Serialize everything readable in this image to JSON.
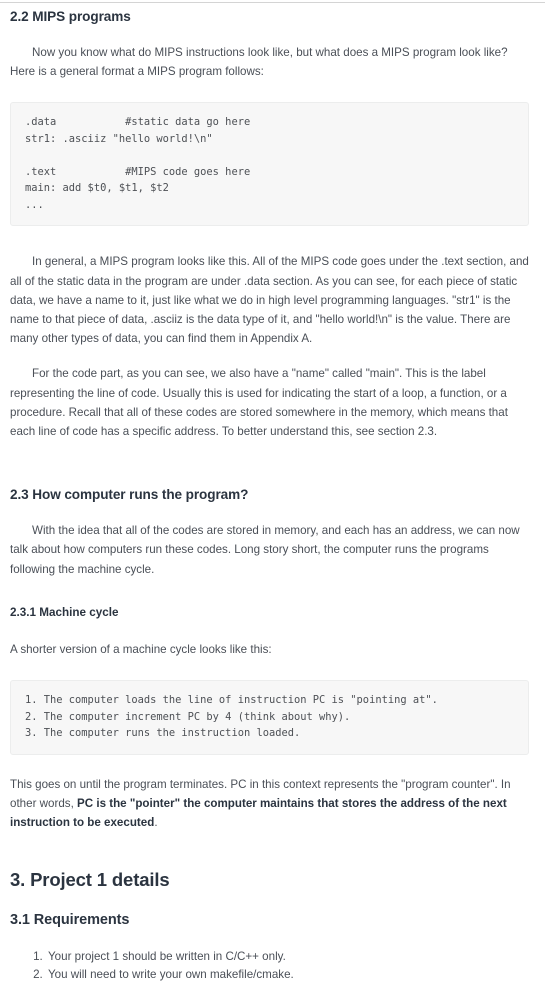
{
  "section_2_2": {
    "heading": "2.2 MIPS programs",
    "intro_paragraph": "Now you know what do MIPS instructions look like, but what does a MIPS program look like? Here is a general format a MIPS program follows:",
    "code_block": ".data           #static data go here\nstr1: .asciiz \"hello world!\\n\"\n\n.text           #MIPS code goes here\nmain: add $t0, $t1, $t2\n...",
    "paragraph_general": "In general, a MIPS program looks like this. All of the MIPS code goes under the .text section, and all of the static data in the program are under .data section. As you can see, for each piece of static data, we have a name to it, just like what we do in high level programming languages. \"str1\" is the name to that piece of data, .asciiz is the data type of it, and \"hello world!\\n\" is the value. There are many other types of data, you can find them in Appendix A.",
    "paragraph_code_part": "For the code part, as you can see, we also have a \"name\" called \"main\". This is the label representing the line of code. Usually this is used for indicating the start of a loop, a function, or a procedure. Recall that all of these codes are stored somewhere in the memory, which means that each line of code has a specific address. To better understand this, see section 2.3."
  },
  "section_2_3": {
    "heading": "2.3 How computer runs the program?",
    "intro_paragraph": "With the idea that all of the codes are stored in memory, and each has an address, we can now talk about how computers run these codes. Long story short, the computer runs the programs following the machine cycle.",
    "subsection_2_3_1": {
      "heading": "2.3.1 Machine cycle",
      "lead_in": "A shorter version of a machine cycle looks like this:",
      "code_block": "1. The computer loads the line of instruction PC is \"pointing at\".\n2. The computer increment PC by 4 (think about why).\n3. The computer runs the instruction loaded.",
      "closing_text_1": "This goes on until the program terminates. PC in this context represents the \"program counter\". In other words, ",
      "closing_text_bold": "PC is the \"pointer\" the computer maintains that stores the address of the next instruction to be executed",
      "closing_text_2": "."
    }
  },
  "section_3": {
    "heading": "3. Project 1 details",
    "subsection_3_1": {
      "heading": "3.1 Requirements",
      "items": [
        "Your project 1 should be written in C/C++ only.",
        "You will need to write your own makefile/cmake."
      ]
    }
  },
  "colors": {
    "heading": "#2b3440",
    "body_text": "#4a4f57",
    "code_background": "#f7f7f7",
    "code_border": "#eceded",
    "rule": "#d4d4d4"
  }
}
